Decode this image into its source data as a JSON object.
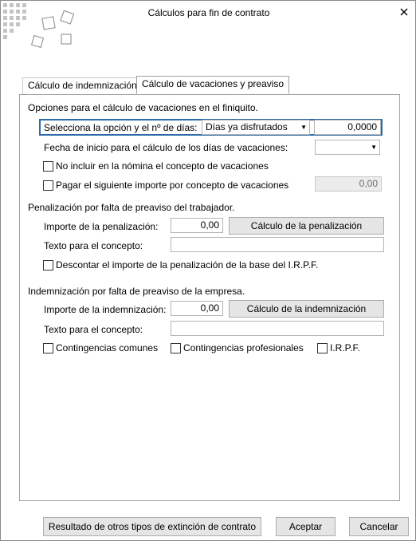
{
  "window": {
    "title": "Cálculos para fin de contrato"
  },
  "tabs": [
    {
      "label": "Cálculo de indemnización",
      "active": false
    },
    {
      "label": "Cálculo de vacaciones y preaviso",
      "active": true
    }
  ],
  "vacaciones": {
    "heading": "Opciones para el cálculo de vacaciones en el finiquito.",
    "option_label": "Selecciona la opción y el nº de días:",
    "option_value": "Días ya disfrutados",
    "days_value": "0,0000",
    "start_date_label": "Fecha de inicio para el cálculo de los días de vacaciones:",
    "start_date_value": "",
    "no_incluir_label": "No incluir en la nómina el concepto de vacaciones",
    "pagar_label": "Pagar el siguiente importe por concepto de vacaciones",
    "pagar_value": "0,00"
  },
  "penalizacion": {
    "heading": "Penalización por falta de preaviso del trabajador.",
    "importe_label": "Importe de la penalización:",
    "importe_value": "0,00",
    "calc_button": "Cálculo de la penalización",
    "texto_label": "Texto para el concepto:",
    "texto_value": "",
    "descontar_label": "Descontar el importe de la penalización de la base del I.R.P.F."
  },
  "indemnizacion": {
    "heading": "Indemnización por falta de preaviso de la empresa.",
    "importe_label": "Importe de la indemnización:",
    "importe_value": "0,00",
    "calc_button": "Cálculo de la indemnización",
    "texto_label": "Texto para el concepto:",
    "texto_value": "",
    "contingencias_comunes_label": "Contingencias comunes",
    "contingencias_profesionales_label": "Contingencias profesionales",
    "irpf_label": "I.R.P.F."
  },
  "footer": {
    "otros_button": "Resultado de otros tipos de extinción de contrato",
    "aceptar_button": "Aceptar",
    "cancelar_button": "Cancelar"
  },
  "icons": {
    "logo": "squares-logo-icon",
    "close": "close-icon",
    "dropdown": "chevron-down-icon"
  },
  "colors": {
    "focus_border": "#2b6aa8",
    "logo_squares": "#b0b0b0"
  }
}
